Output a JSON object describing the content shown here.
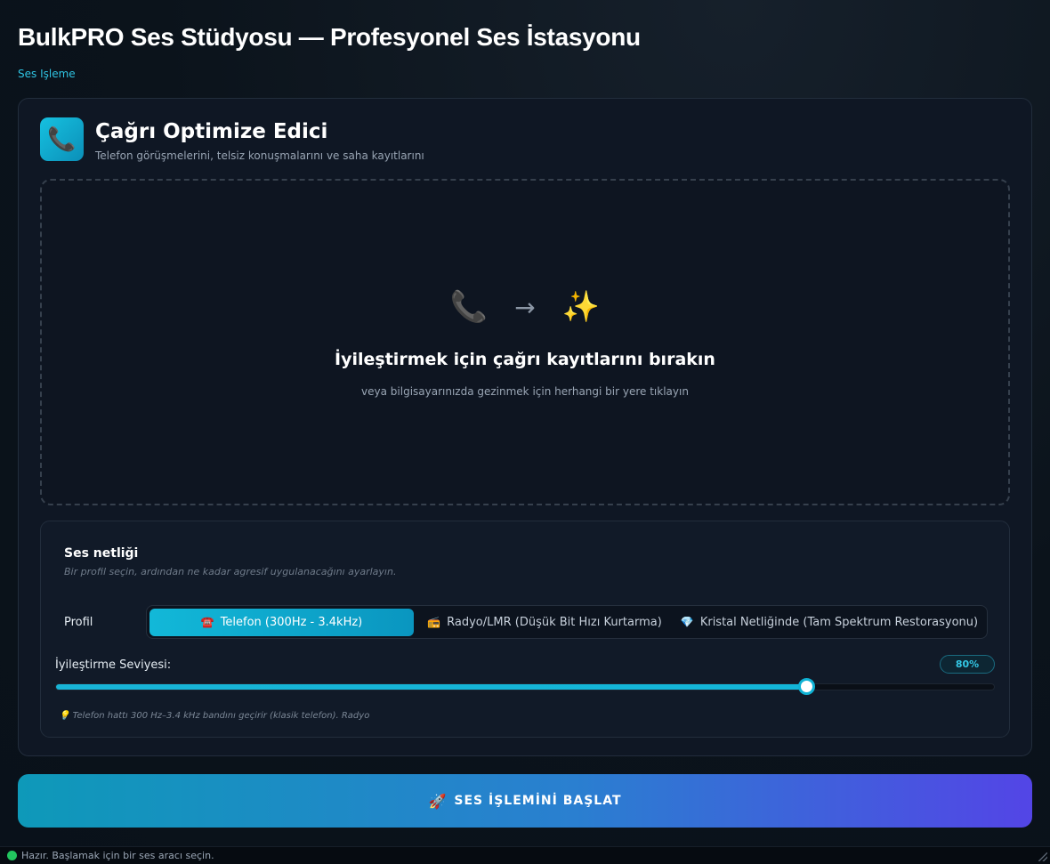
{
  "app": {
    "title": "BulkPRO Ses Stüdyosu — Profesyonel Ses İstasyonu",
    "breadcrumb": "Ses Işleme"
  },
  "tool": {
    "icon": "telephone-receiver-icon",
    "title": "Çağrı Optimize Edici",
    "subtitle": "Telefon görüşmelerini, telsiz konuşmalarını ve saha kayıtlarını"
  },
  "dropzone": {
    "icons": {
      "source": "📞",
      "arrow": "→",
      "target": "✨"
    },
    "title": "İyileştirmek için çağrı kayıtlarını bırakın",
    "subtitle": "veya bilgisayarınızda gezinmek için herhangi bir yere tıklayın"
  },
  "settings": {
    "title": "Ses netliği",
    "description": "Bir profil seçin, ardından ne kadar agresif uygulanacağını ayarlayın.",
    "profile_label": "Profil",
    "profiles": [
      {
        "icon": "☎️",
        "label": "Telefon (300Hz - 3.4kHz)",
        "active": true
      },
      {
        "icon": "📻",
        "label": "Radyo/LMR (Düşük Bit Hızı Kurtarma)",
        "active": false
      },
      {
        "icon": "💎",
        "label": "Kristal Netliğinde (Tam Spektrum Restorasyonu)",
        "active": false
      }
    ],
    "level_label": "İyileştirme Seviyesi:",
    "level_value": 80,
    "level_text": "80%",
    "hint_icon": "💡",
    "hint": "Telefon hattı 300 Hz–3.4 kHz bandını geçirir (klasik telefon). Radyo"
  },
  "actions": {
    "start_icon": "🚀",
    "start_label": "SES İŞLEMİNİ BAŞLAT"
  },
  "status": {
    "text": "Hazır. Başlamak için bir ses aracı seçin.",
    "color": "#22c55e"
  },
  "colors": {
    "accent": "#13b6d8",
    "button_gradient_start": "#0e99b9",
    "button_gradient_end": "#5345e6"
  }
}
